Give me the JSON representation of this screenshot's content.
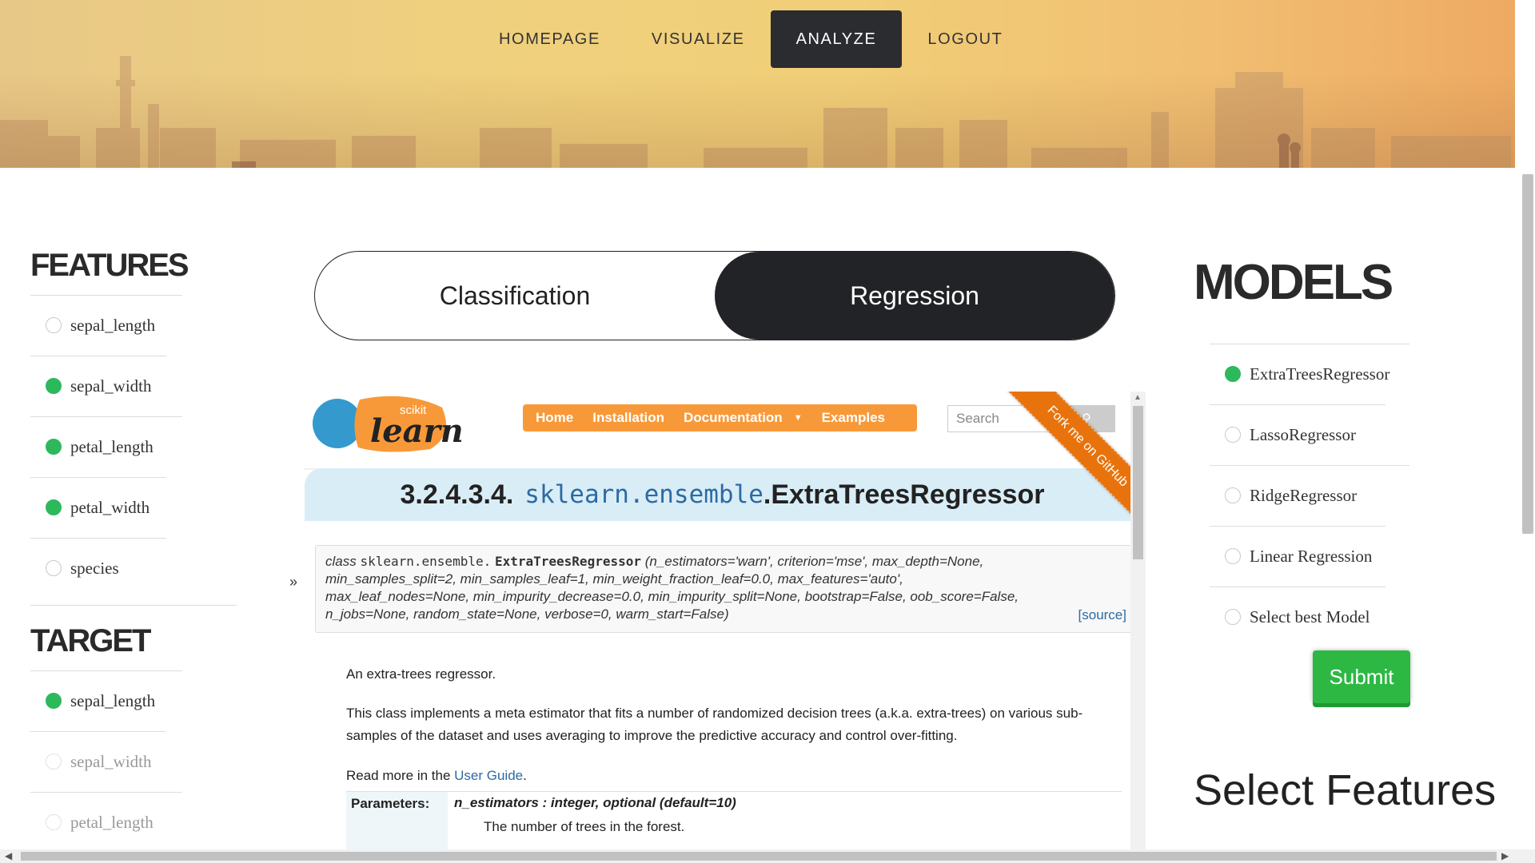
{
  "nav": {
    "items": [
      {
        "label": "HOMEPAGE",
        "active": false
      },
      {
        "label": "VISUALIZE",
        "active": false
      },
      {
        "label": "ANALYZE",
        "active": true
      },
      {
        "label": "LOGOUT",
        "active": false
      }
    ]
  },
  "features": {
    "title": "FEATURES",
    "items": [
      {
        "label": "sepal_length",
        "selected": false
      },
      {
        "label": "sepal_width",
        "selected": true
      },
      {
        "label": "petal_length",
        "selected": true
      },
      {
        "label": "petal_width",
        "selected": true
      },
      {
        "label": "species",
        "selected": false
      }
    ]
  },
  "target": {
    "title": "TARGET",
    "items": [
      {
        "label": "sepal_length",
        "selected": true
      },
      {
        "label": "sepal_width",
        "selected": false
      },
      {
        "label": "petal_length",
        "selected": false
      }
    ]
  },
  "mode_toggle": {
    "options": [
      "Classification",
      "Regression"
    ],
    "selected": "Regression"
  },
  "docs": {
    "logo_small": "scikit",
    "logo_big": "learn",
    "nav": [
      "Home",
      "Installation",
      "Documentation",
      "Examples"
    ],
    "search_placeholder": "Search",
    "ribbon": "Fork me on GitHub",
    "expand_glyph": "»",
    "title_number": "3.2.4.3.4.",
    "title_module": "sklearn.ensemble",
    "title_class": ".ExtraTreesRegressor",
    "sig_kw": "class",
    "sig_module": "sklearn.ensemble.",
    "sig_class": "ExtraTreesRegressor",
    "sig_line1": "(n_estimators='warn', criterion='mse', max_depth=None,",
    "sig_line2": "min_samples_split=2, min_samples_leaf=1, min_weight_fraction_leaf=0.0, max_features='auto',",
    "sig_line3": "max_leaf_nodes=None, min_impurity_decrease=0.0, min_impurity_split=None, bootstrap=False, oob_score=False,",
    "sig_line4": "n_jobs=None, random_state=None, verbose=0, warm_start=False)",
    "source_link": "[source]",
    "summary": "An extra-trees regressor.",
    "description": "This class implements a meta estimator that fits a number of randomized decision trees (a.k.a. extra-trees) on various sub-samples of the dataset and uses averaging to improve the predictive accuracy and control over-fitting.",
    "read_more_prefix": "Read more in the ",
    "read_more_link": "User Guide",
    "read_more_suffix": ".",
    "params_label": "Parameters:",
    "param_name": "n_estimators : integer, optional (default=10)",
    "param_desc": "The number of trees in the forest."
  },
  "models": {
    "title": "MODELS",
    "items": [
      {
        "label": "ExtraTreesRegressor",
        "selected": true
      },
      {
        "label": "LassoRegressor",
        "selected": false
      },
      {
        "label": "RidgeRegressor",
        "selected": false
      },
      {
        "label": "Linear Regression",
        "selected": false
      },
      {
        "label": "Select best Model",
        "selected": false
      }
    ],
    "submit_label": "Submit",
    "select_features_title": "Select Features"
  },
  "colors": {
    "accent_dark": "#222326",
    "selected_green": "#2eb85c",
    "submit_green": "#2db844",
    "sklearn_orange": "#f89939",
    "doc_title_bg": "#d9edf7"
  }
}
